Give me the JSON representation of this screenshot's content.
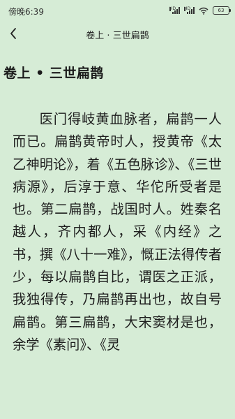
{
  "status_bar": {
    "time": "傍晚6:39",
    "signal1_label": "HD",
    "signal2_label": "HD",
    "battery": "63"
  },
  "header": {
    "back_icon": "chevron-left-icon",
    "title": "卷上 · 三世扁鹊"
  },
  "chapter": {
    "title": "卷上 • 三世扁鹊"
  },
  "content": {
    "paragraph": "医门得岐黄血脉者，扁鹊一人而已。扁鹊黄帝时人，授黄帝《太乙神明论》，着《五色脉诊》、《三世病源》，后淳于意、华佗所受者是也。第二扁鹊，战国时人。姓秦名越人，齐内都人，采《内经》之书，撰《八十一难》，慨正法得传者少，每以扁鹊自比，谓医之正派，我独得传，乃扁鹊再出也，故自号扁鹊。第三扁鹊，大宋窦材是也，余学《素问》、《灵"
  },
  "colors": {
    "background": "#d6ecd6",
    "text": "#1f1f1f"
  }
}
